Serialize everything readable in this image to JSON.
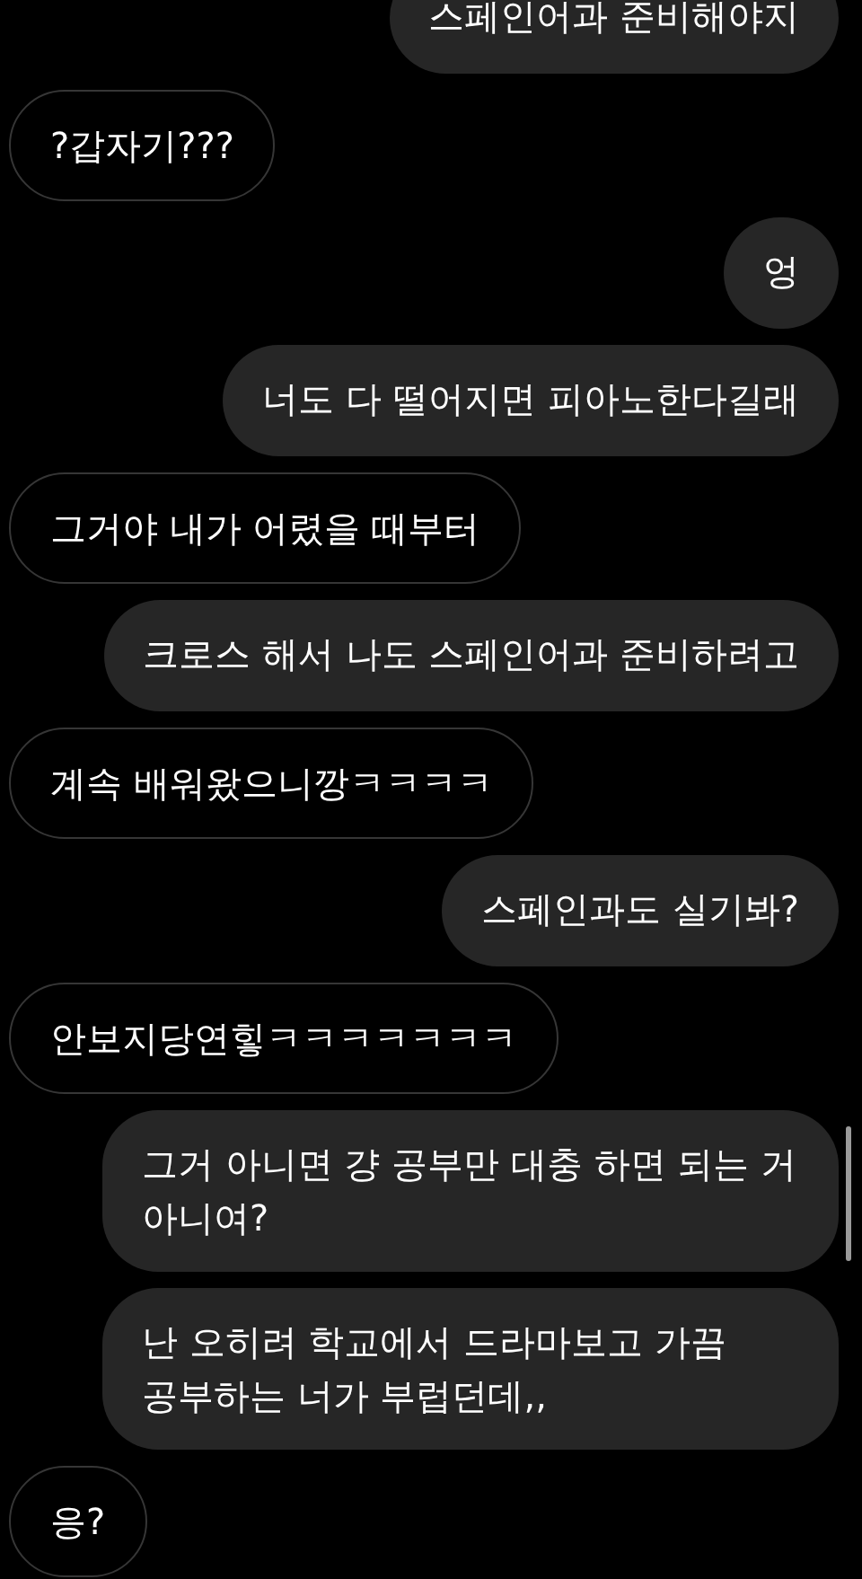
{
  "messages": [
    {
      "kind": "sent",
      "text": "스페인어과 준비해야지"
    },
    {
      "kind": "received",
      "text": "?갑자기???"
    },
    {
      "kind": "sent",
      "text": "엉"
    },
    {
      "kind": "sent",
      "text": "너도 다 떨어지면 피아노한다길래"
    },
    {
      "kind": "received",
      "text": "그거야 내가 어렸을 때부터"
    },
    {
      "kind": "sent",
      "text": "크로스 해서 나도 스페인어과 준비하려고"
    },
    {
      "kind": "received",
      "text": "계속 배워왔으니깡ㅋㅋㅋㅋ"
    },
    {
      "kind": "sent",
      "text": "스페인과도 실기봐?"
    },
    {
      "kind": "received",
      "text": "안보지당연힣ㅋㅋㅋㅋㅋㅋㅋ"
    },
    {
      "kind": "sent",
      "text": "그거 아니면 걍 공부만 대충 하면 되는 거 아니여?"
    },
    {
      "kind": "sent",
      "text": "난 오히려 학교에서 드라마보고 가끔 공부하는 너가 부럽던데,,"
    },
    {
      "kind": "received",
      "text": "응?"
    }
  ]
}
